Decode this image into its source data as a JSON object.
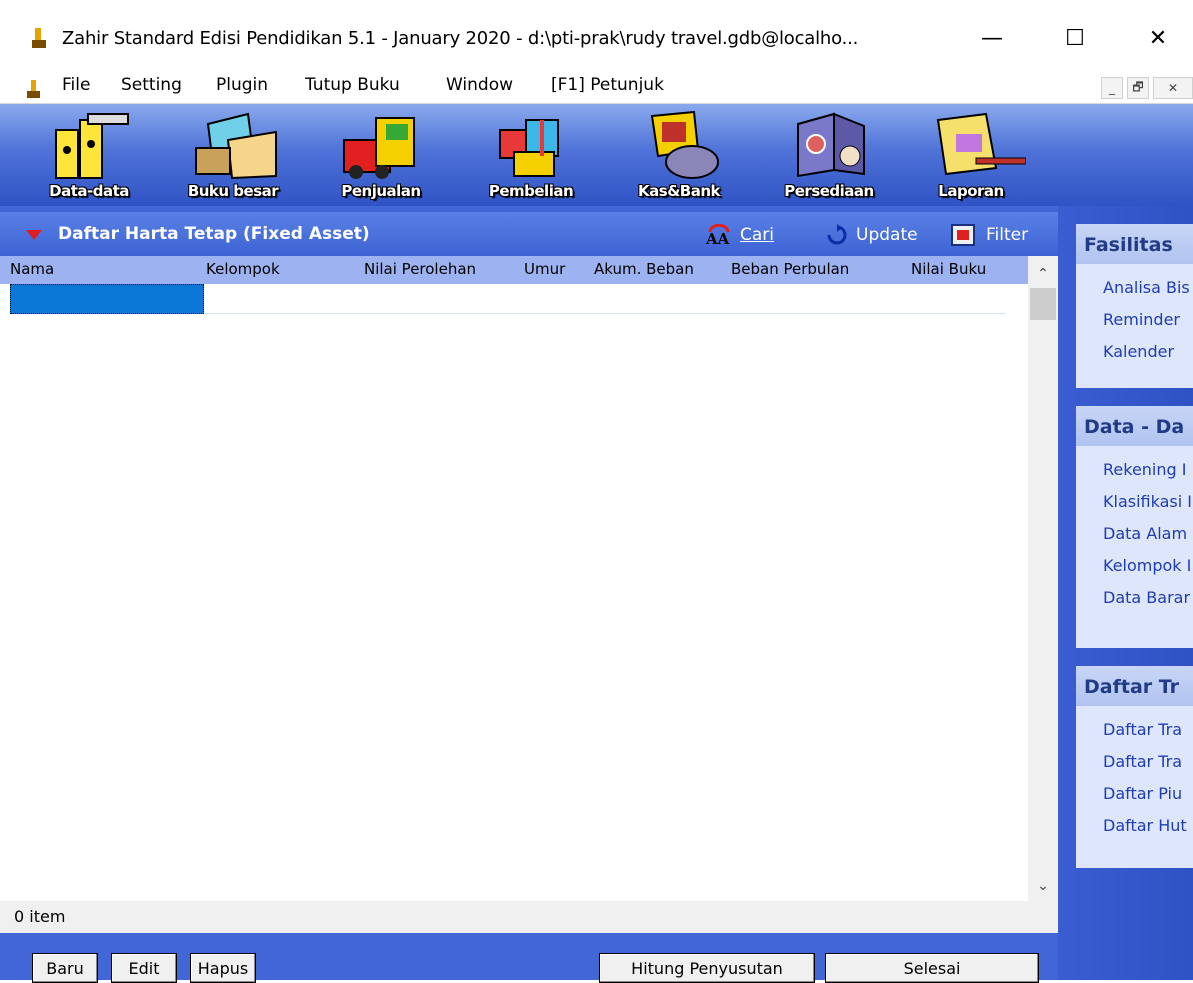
{
  "window": {
    "title": "Zahir Standard Edisi Pendidikan 5.1 - January 2020 - d:\\pti-prak\\rudy travel.gdb@localho...",
    "minimize": "—",
    "maximize": "☐",
    "close": "✕"
  },
  "menu": {
    "file": "File",
    "setting": "Setting",
    "plugin": "Plugin",
    "tutup_buku": "Tutup Buku",
    "window": "Window",
    "petunjuk": "[F1] Petunjuk",
    "mdi_min": "_",
    "mdi_restore": "🗗",
    "mdi_close": "✕"
  },
  "toolbar": {
    "items": [
      {
        "label": "Data-data",
        "icon": "folders-icon"
      },
      {
        "label": "Buku besar",
        "icon": "ledger-icon"
      },
      {
        "label": "Penjualan",
        "icon": "sales-truck-icon"
      },
      {
        "label": "Pembelian",
        "icon": "gift-boxes-icon"
      },
      {
        "label": "Kas&Bank",
        "icon": "money-bag-icon"
      },
      {
        "label": "Persediaan",
        "icon": "inventory-box-icon"
      },
      {
        "label": "Laporan",
        "icon": "report-scroll-icon"
      }
    ]
  },
  "panel": {
    "title": "Daftar Harta Tetap (Fixed Asset)",
    "cari": "Cari",
    "update": "Update",
    "filter": "Filter"
  },
  "columns": [
    "Nama",
    "Kelompok",
    "Nilai Perolehan",
    "Umur",
    "Akum. Beban",
    "Beban Perbulan",
    "Nilai Buku"
  ],
  "status": "0 item",
  "buttons": {
    "baru": "Baru",
    "edit": "Edit",
    "hapus": "Hapus",
    "hitung": "Hitung Penyusutan",
    "selesai": "Selesai"
  },
  "sidebar": {
    "fasilitas": {
      "title": "Fasilitas",
      "items": [
        "Analisa Bis",
        "Reminder",
        "Kalender"
      ]
    },
    "data": {
      "title": "Data - Da",
      "items": [
        "Rekening I",
        "Klasifikasi I",
        "Data Alam",
        "Kelompok I",
        "Data Barar"
      ]
    },
    "daftar": {
      "title": "Daftar Tr",
      "items": [
        "Daftar Tra",
        "Daftar Tra",
        "Daftar Piu",
        "Daftar Hut"
      ]
    }
  },
  "colors": {
    "accent": "#4167d6",
    "header": "#9db3f1",
    "selection": "#0b78d8"
  }
}
